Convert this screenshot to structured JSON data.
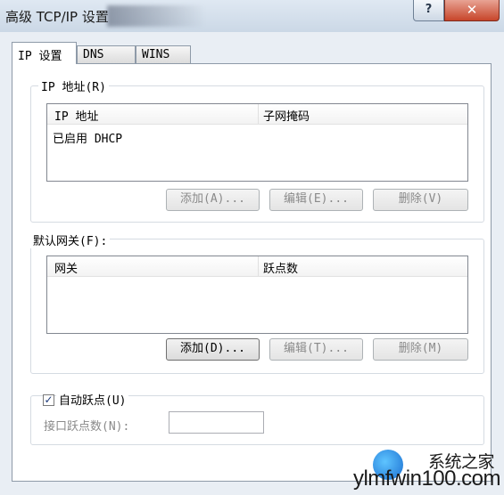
{
  "window": {
    "title": "高级 TCP/IP 设置",
    "help_label": "?",
    "close_label": "✕"
  },
  "tabs": [
    {
      "label": "IP 设置"
    },
    {
      "label": "DNS"
    },
    {
      "label": "WINS"
    }
  ],
  "ip_group": {
    "legend": "IP 地址(R)",
    "columns": [
      "IP 地址",
      "子网掩码"
    ],
    "rows": [
      "已启用 DHCP"
    ],
    "buttons": {
      "add": "添加(A)...",
      "edit": "编辑(E)...",
      "delete": "删除(V)"
    }
  },
  "gateway_group": {
    "legend": "默认网关(F):",
    "columns": [
      "网关",
      "跃点数"
    ],
    "buttons": {
      "add": "添加(D)...",
      "edit": "编辑(T)...",
      "delete": "删除(M)"
    }
  },
  "metric": {
    "auto_label": "自动跃点(U)",
    "auto_checked": "✓",
    "interface_label": "接口跃点数(N):",
    "interface_value": ""
  },
  "watermark": {
    "text": "ylmfwin100.com",
    "tagline": "系统之家"
  }
}
